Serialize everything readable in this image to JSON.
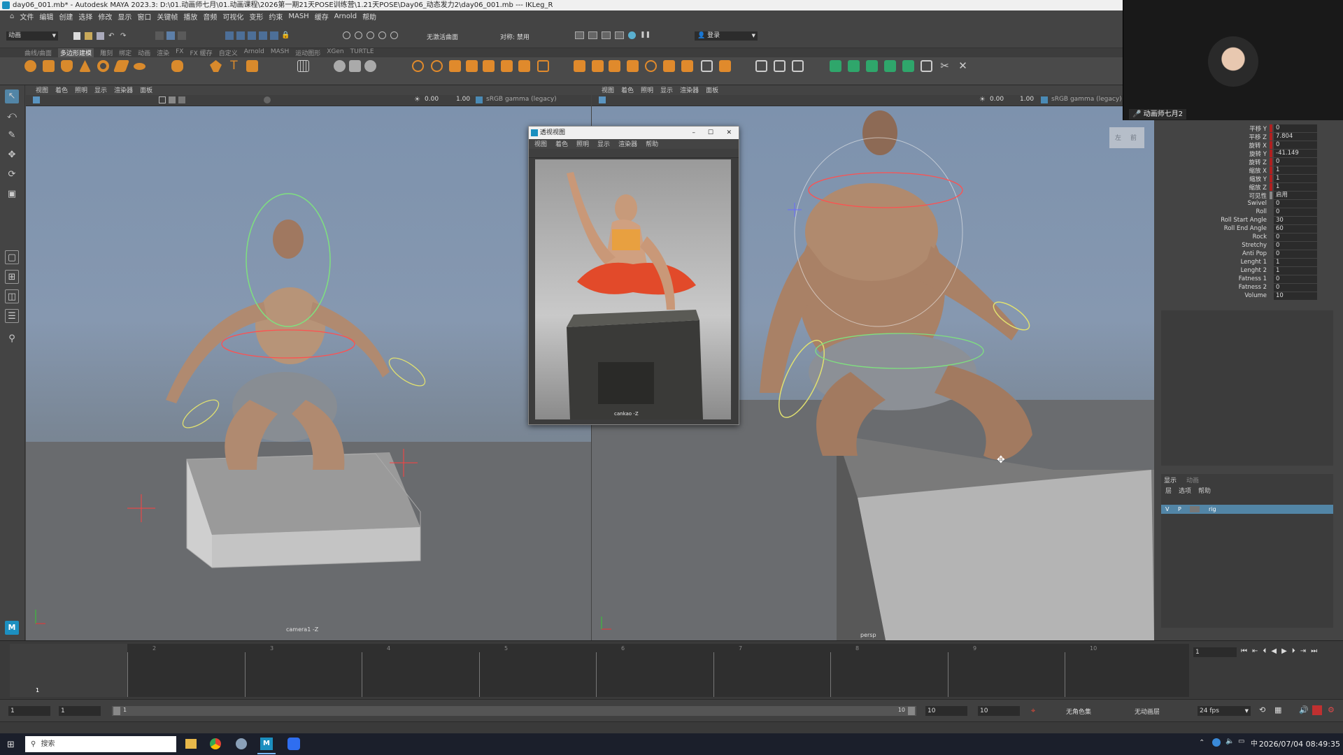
{
  "window": {
    "title": "day06_001.mb* - Autodesk MAYA 2023.3: D:\\01.动画师七月\\01.动画课程\\2026第一期21天POSE训练营\\1.21天POSE\\Day06_动态发力2\\day06_001.mb  ---  IKLeg_R"
  },
  "menu": [
    "文件",
    "编辑",
    "创建",
    "选择",
    "修改",
    "显示",
    "窗口",
    "关键帧",
    "播放",
    "音频",
    "可视化",
    "变形",
    "约束",
    "MASH",
    "缓存",
    "Arnold",
    "帮助"
  ],
  "status": {
    "mode": "动画",
    "no_live_surface": "无激活曲面",
    "symmetry": "对称: 禁用",
    "login": "登录"
  },
  "shelf_tabs": [
    "曲线/曲面",
    "多边形建模",
    "雕刻",
    "绑定",
    "动画",
    "渲染",
    "FX",
    "FX 缓存",
    "自定义",
    "Arnold",
    "MASH",
    "运动图形",
    "XGen",
    "TURTLE"
  ],
  "viewport_menu": [
    "视图",
    "着色",
    "照明",
    "显示",
    "渲染器",
    "面板"
  ],
  "viewport_left": {
    "near": "0.00",
    "far": "1.00",
    "colorspace": "sRGB gamma (legacy)",
    "camera_label": "camera1 -Z"
  },
  "viewport_right": {
    "near": "0.00",
    "far": "1.00",
    "colorspace": "sRGB gamma (legacy)",
    "camera_label": "persp",
    "view_cube_left": "左",
    "view_cube_front": "前"
  },
  "float_window": {
    "title": "透视视图",
    "menu": [
      "视图",
      "着色",
      "照明",
      "显示",
      "渲染器",
      "帮助"
    ],
    "camera_label": "cankao -Z"
  },
  "webcam": {
    "name": "动画师七月2"
  },
  "channels": [
    {
      "label": "平移 Y",
      "value": "0"
    },
    {
      "label": "平移 Z",
      "value": "7.804"
    },
    {
      "label": "旋转 X",
      "value": "0"
    },
    {
      "label": "旋转 Y",
      "value": "-41.149"
    },
    {
      "label": "旋转 Z",
      "value": "0"
    },
    {
      "label": "缩放 X",
      "value": "1"
    },
    {
      "label": "缩放 Y",
      "value": "1"
    },
    {
      "label": "缩放 Z",
      "value": "1"
    },
    {
      "label": "可见性",
      "value": "启用"
    },
    {
      "label": "Swivel",
      "value": "0"
    },
    {
      "label": "Roll",
      "value": "0"
    },
    {
      "label": "Roll Start Angle",
      "value": "30"
    },
    {
      "label": "Roll End Angle",
      "value": "60"
    },
    {
      "label": "Rock",
      "value": "0"
    },
    {
      "label": "Stretchy",
      "value": "0"
    },
    {
      "label": "Anti Pop",
      "value": "0"
    },
    {
      "label": "Lenght 1",
      "value": "1"
    },
    {
      "label": "Lenght 2",
      "value": "1"
    },
    {
      "label": "Fatness 1",
      "value": "0"
    },
    {
      "label": "Fatness 2",
      "value": "0"
    },
    {
      "label": "Volume",
      "value": "10"
    }
  ],
  "layer_editor": {
    "tabs": [
      "显示",
      "动画"
    ],
    "menu": [
      "层",
      "选项",
      "帮助"
    ],
    "layer": {
      "v": "V",
      "p": "P",
      "name": "rig"
    }
  },
  "timeline": {
    "ticks": [
      "1",
      "2",
      "3",
      "4",
      "5",
      "6",
      "7",
      "8",
      "9",
      "10"
    ],
    "current_frame": "1",
    "current_frame_field": "1"
  },
  "range": {
    "start": "1",
    "anim_start": "1",
    "slider_start": "1",
    "slider_end": "10",
    "end": "10",
    "anim_end": "10",
    "char_set": "无角色集",
    "anim_layer": "无动画层",
    "fps": "24 fps"
  },
  "taskbar": {
    "search": "搜索",
    "datetime": "2026/07/04 08:49:35"
  }
}
